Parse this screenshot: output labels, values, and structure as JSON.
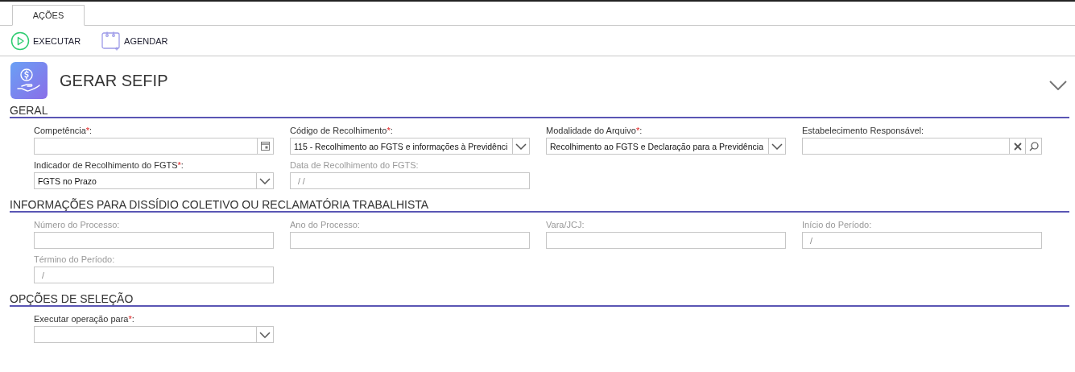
{
  "tabs": [
    {
      "label": "AÇÕES",
      "selected": true
    }
  ],
  "toolbar": [
    {
      "kind": "run",
      "label": "EXECUTAR"
    },
    {
      "kind": "schedule",
      "label": "AGENDAR"
    }
  ],
  "header": {
    "title": "GERAR SEFIP",
    "expanded": false
  },
  "sections": [
    {
      "title": "GERAL",
      "fields": [
        {
          "label": "Competência",
          "asterisk": "*",
          "label_end": ":",
          "disabled": false,
          "kind": "date"
        },
        {
          "label": "Código de Recolhimento",
          "asterisk": "*",
          "label_end": ":",
          "disabled": false,
          "kind": "select",
          "value": "115 - Recolhimento ao FGTS e informações à Previdênci"
        },
        {
          "label": "Modalidade do Arquivo",
          "asterisk": "*",
          "label_end": ":",
          "disabled": false,
          "kind": "select",
          "value": "Recolhimento ao FGTS e Declaração para a Previdência"
        },
        {
          "label": "Estabelecimento Responsável:",
          "disabled": false,
          "kind": "lookup"
        },
        {
          "label": "Indicador de Recolhimento do FGTS",
          "asterisk": "*",
          "label_end": ":",
          "disabled": false,
          "kind": "select",
          "value": "FGTS no Prazo"
        },
        {
          "label": "Data de Recolhimento do FGTS:",
          "disabled": true,
          "kind": "text",
          "value": " /  /"
        }
      ]
    },
    {
      "title": "INFORMAÇÕES PARA DISSÍDIO COLETIVO OU RECLAMATÓRIA TRABALHISTA",
      "fields": [
        {
          "label": "Número do Processo:",
          "disabled": true,
          "kind": "text"
        },
        {
          "label": "Ano do Processo:",
          "disabled": true,
          "kind": "text"
        },
        {
          "label": "Vara/JCJ:",
          "disabled": true,
          "kind": "text"
        },
        {
          "label": "Início do Período:",
          "disabled": true,
          "kind": "text",
          "value": "/"
        },
        {
          "label": "Término do Período:",
          "disabled": true,
          "kind": "text",
          "value": "/"
        }
      ]
    },
    {
      "title": "OPÇÕES DE SELEÇÃO",
      "fields": [
        {
          "label": "Executar operação para",
          "asterisk": "*",
          "label_end": ":",
          "disabled": false,
          "kind": "select"
        }
      ]
    }
  ]
}
